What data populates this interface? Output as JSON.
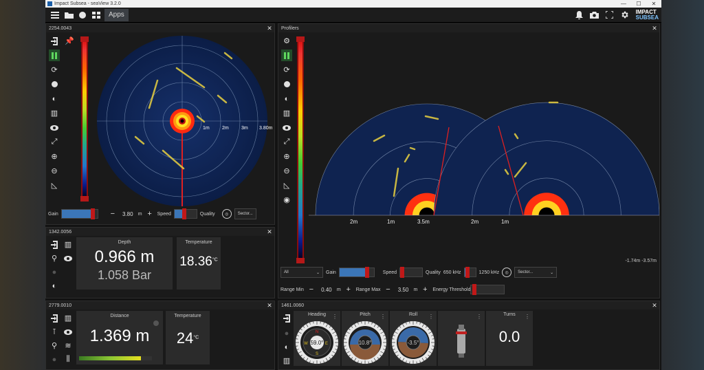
{
  "window": {
    "title": "Impact Subsea - seaView 3.2.0",
    "min": "—",
    "max": "☐",
    "close": "✕"
  },
  "appbar": {
    "apps_label": "Apps",
    "logo_line1": "IMPACT",
    "logo_line2": "SUBSEA"
  },
  "sonar1": {
    "id": "2254.0043",
    "gain_label": "Gain",
    "gain": 0.86,
    "range_value": "3.80",
    "range_unit": "m",
    "speed_label": "Speed",
    "speed": 0.45,
    "quality_label": "Quality",
    "sector_label": "Sector...",
    "rings": [
      "1m",
      "2m",
      "3m",
      "3.80m"
    ]
  },
  "depth": {
    "id": "1342.0056",
    "depth_title": "Depth",
    "depth_value": "0.966 m",
    "pressure_value": "1.058 Bar",
    "temp_title": "Temperature",
    "temp_value": "18.36",
    "temp_unit": "°C"
  },
  "alt": {
    "id": "2779.0010",
    "distance_title": "Distance",
    "distance_value": "1.369 m",
    "temp_title": "Temperature",
    "temp_value": "24",
    "temp_unit": "°C",
    "bar": 0.85
  },
  "profilers": {
    "id": "Profilers",
    "left_labels": [
      "2m",
      "1m",
      "3.5m"
    ],
    "right_labels": [
      "2m",
      "1m"
    ],
    "coords": "-1.74m -3.57m",
    "mode": "All",
    "gain_label": "Gain",
    "gain": 0.8,
    "speed_label": "Speed",
    "speed": 0.1,
    "quality_label": "Quality",
    "freq_a": "650 kHz",
    "freq_b": "1250 kHz",
    "freq_pos": 0.3,
    "sector_label": "Sector...",
    "range_min_label": "Range Min",
    "range_min": "0.40",
    "range_max_label": "Range Max",
    "range_max": "3.50",
    "unit": "m",
    "energy_label": "Energy Threshold"
  },
  "ahrs": {
    "id": "1461.0060",
    "heading_title": "Heading",
    "heading_value": "59.0°",
    "pitch_title": "Pitch",
    "pitch_value": "10.8°",
    "roll_title": "Roll",
    "roll_value": "-3.5°",
    "turns_title": "Turns",
    "turns_value": "0.0",
    "compass_labels": [
      "N",
      "E",
      "S",
      "W"
    ]
  },
  "colors": {
    "accent": "#c01818",
    "bar": "#3b76b8",
    "panel": "#1a1a1a",
    "card": "#2b2b2b"
  }
}
